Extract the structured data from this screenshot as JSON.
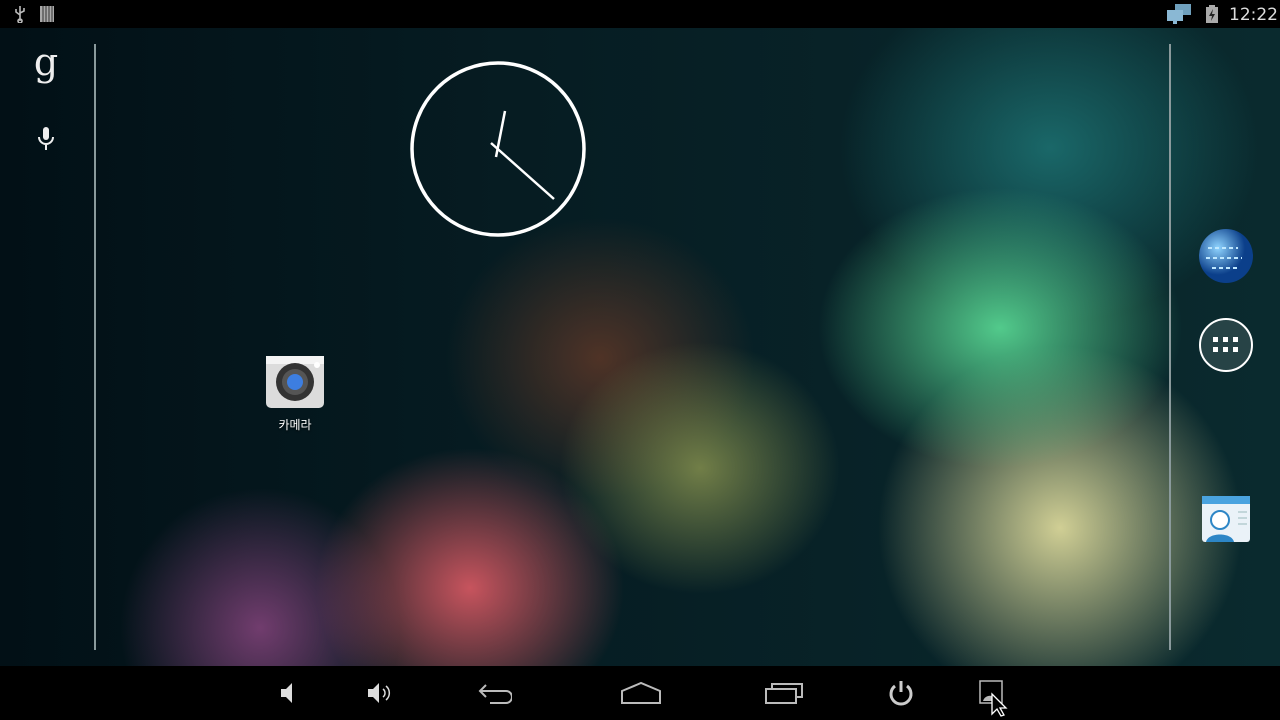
{
  "status_bar": {
    "time": "12:22",
    "left_icons": [
      "usb-icon",
      "storage-icon"
    ],
    "right_icons": [
      "network-icon",
      "battery-charging-icon"
    ]
  },
  "search_bar": {
    "google_icon": "g",
    "voice_icon": "mic-icon"
  },
  "clock": {
    "hour_hand": "12:22",
    "type": "analog"
  },
  "desktop": {
    "apps": [
      {
        "label": "카메라",
        "icon": "camera-icon"
      }
    ]
  },
  "dock": {
    "items": [
      "browser-icon",
      "app-drawer-icon",
      "contacts-icon"
    ]
  },
  "nav_bar": {
    "buttons": [
      "volume-down",
      "volume-up",
      "back",
      "home",
      "recents",
      "power",
      "screenshot"
    ]
  }
}
